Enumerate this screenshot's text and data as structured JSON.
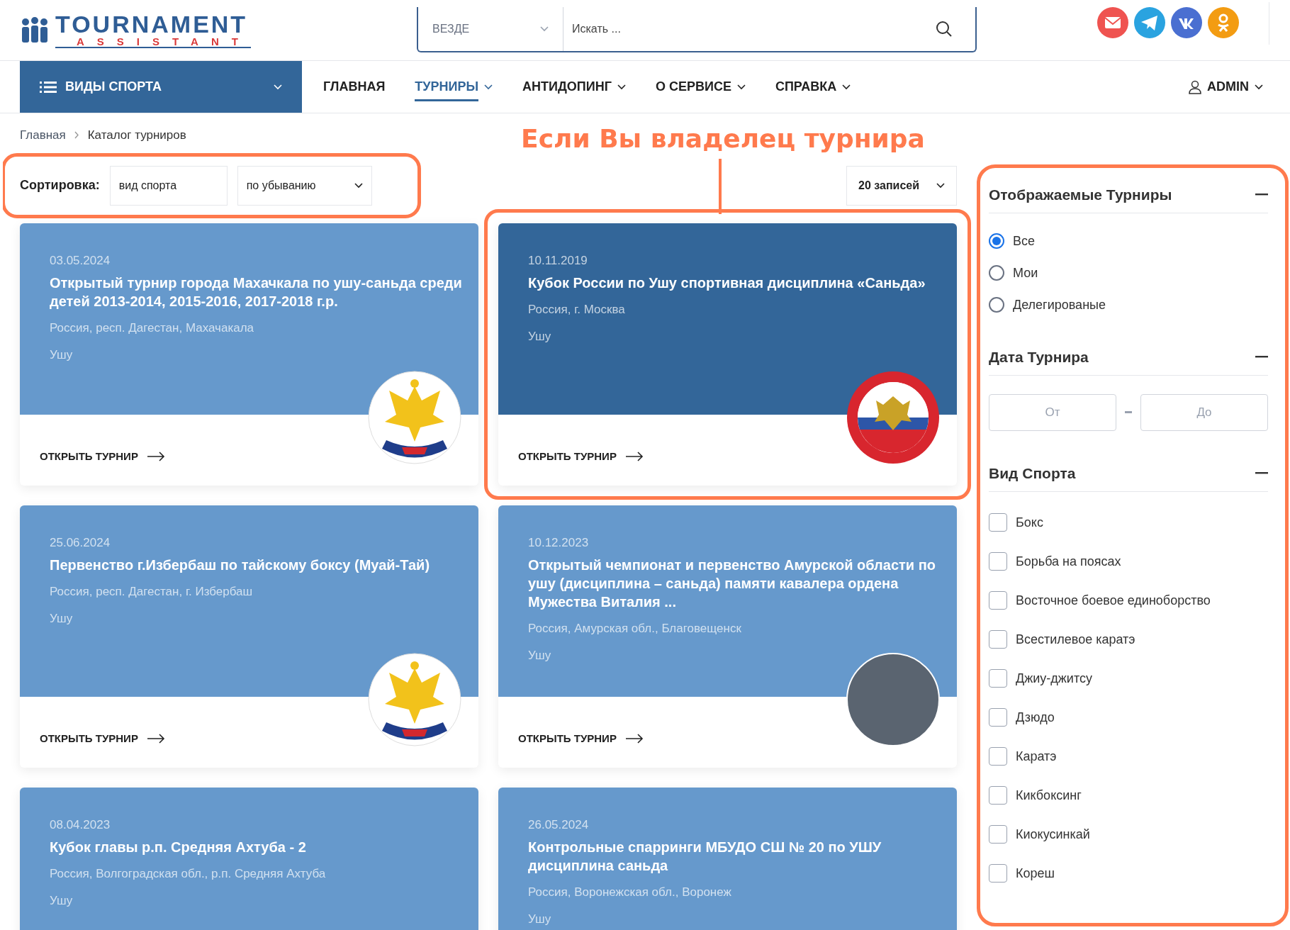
{
  "logo": {
    "line1": "TOURNAMENT",
    "line2": "ASSISTANT"
  },
  "search": {
    "scope": "ВЕЗДЕ",
    "placeholder": "Искать ..."
  },
  "nav": {
    "sports_menu": "ВИДЫ СПОРТА",
    "items": [
      {
        "label": "ГЛАВНАЯ",
        "selected": false,
        "dropdown": false
      },
      {
        "label": "ТУРНИРЫ",
        "selected": true,
        "dropdown": true
      },
      {
        "label": "АНТИДОПИНГ",
        "selected": false,
        "dropdown": true
      },
      {
        "label": "О СЕРВИСЕ",
        "selected": false,
        "dropdown": true
      },
      {
        "label": "СПРАВКА",
        "selected": false,
        "dropdown": true
      }
    ],
    "user": "ADMIN"
  },
  "breadcrumb": [
    "Главная",
    "Каталог турниров"
  ],
  "annotation": "Если Вы владелец турнира",
  "sort": {
    "label": "Сортировка:",
    "field": "вид спорта",
    "order": "по убыванию",
    "page_size": "20 записей"
  },
  "cards": [
    {
      "date": "03.05.2024",
      "title": "Открытый турнир города Махачкала по ушу-саньда среди детей 2013-2014, 2015-2016, 2017-2018 г.р.",
      "place": "Россия, респ. Дагестан, Махачакала",
      "sport": "Ушу",
      "action": "ОТКРЫТЬ ТУРНИР",
      "highlighted": false,
      "kind": "gold-emblem"
    },
    {
      "date": "10.11.2019",
      "title": "Кубок России по Ушу спортивная дисциплина «Саньда»",
      "place": "Россия, г. Москва",
      "sport": "Ушу",
      "action": "ОТКРЫТЬ ТУРНИР",
      "highlighted": true,
      "kind": "red-emblem"
    },
    {
      "date": "25.06.2024",
      "title": "Первенство г.Избербаш по тайскому боксу (Муай-Тай)",
      "place": "Россия, респ. Дагестан, г. Избербаш",
      "sport": "Ушу",
      "action": "ОТКРЫТЬ ТУРНИР",
      "highlighted": false,
      "kind": "gold-emblem"
    },
    {
      "date": "10.12.2023",
      "title": "Открытый чемпионат и первенство Амурской области по ушу (дисциплина – саньда) памяти кавалера ордена Мужества Виталия ...",
      "place": "Россия, Амурская обл., Благовещенск",
      "sport": "Ушу",
      "action": "ОТКРЫТЬ ТУРНИР",
      "highlighted": false,
      "kind": "photo"
    },
    {
      "date": "08.04.2023",
      "title": "Кубок главы р.п. Средняя Ахтуба - 2",
      "place": "Россия, Волгоградская обл., р.п. Средняя Ахтуба",
      "sport": "Ушу",
      "highlighted": false,
      "kind": "plain"
    },
    {
      "date": "26.05.2024",
      "title": "Контрольные спарринги МБУДО СШ № 20 по УШУ дисциплина саньда",
      "place": "Россия, Воронежская обл., Воронеж",
      "sport": "Ушу",
      "highlighted": false,
      "kind": "plain"
    }
  ],
  "filters": {
    "shown": {
      "title": "Отображаемые Турниры",
      "options": [
        {
          "label": "Все",
          "selected": true
        },
        {
          "label": "Мои",
          "selected": false
        },
        {
          "label": "Делегированые",
          "selected": false
        }
      ]
    },
    "date": {
      "title": "Дата Турнира",
      "from_placeholder": "От",
      "to_placeholder": "До"
    },
    "sport": {
      "title": "Вид Спорта",
      "options": [
        {
          "label": "Бокс",
          "checked": false
        },
        {
          "label": "Борьба на поясах",
          "checked": false
        },
        {
          "label": "Восточное боевое единоборство",
          "checked": false
        },
        {
          "label": "Всестилевое каратэ",
          "checked": false
        },
        {
          "label": "Джиу-джитсу",
          "checked": false
        },
        {
          "label": "Дзюдо",
          "checked": false
        },
        {
          "label": "Каратэ",
          "checked": false
        },
        {
          "label": "Кикбоксинг",
          "checked": false
        },
        {
          "label": "Киокусинкай",
          "checked": false
        },
        {
          "label": "Кореш",
          "checked": false
        }
      ]
    }
  }
}
